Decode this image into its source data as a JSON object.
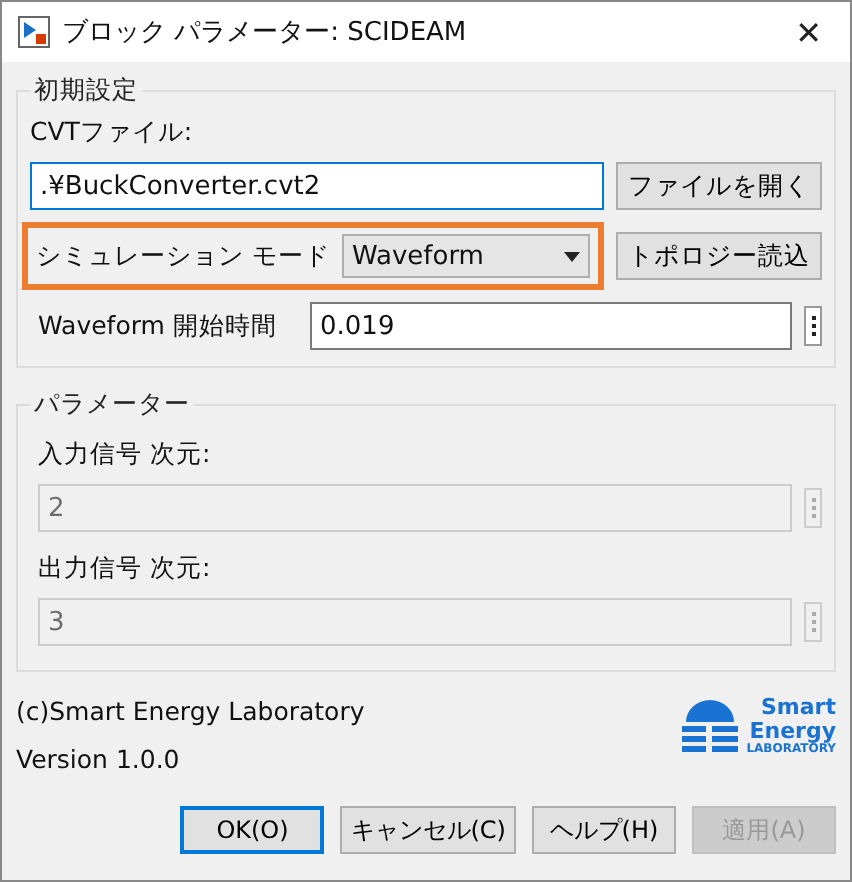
{
  "window": {
    "title": "ブロック パラメーター: SCIDEAM",
    "close": "✕"
  },
  "initial": {
    "title": "初期設定",
    "file_label": "CVTファイル:",
    "file_value": ".¥BuckConverter.cvt2",
    "open_button": "ファイルを開く",
    "mode": {
      "label": "シミュレーション モード",
      "value": "Waveform",
      "highlighted": true
    },
    "topology_button": "トポロジー読込",
    "start": {
      "label": "Waveform 開始時間",
      "value": "0.019"
    }
  },
  "parameters": {
    "title": "パラメーター",
    "fields": [
      {
        "label": "入力信号 次元:",
        "value": "2",
        "disabled": true
      },
      {
        "label": "出力信号 次元:",
        "value": "3",
        "disabled": true
      }
    ]
  },
  "footer": {
    "copyright": "(c)Smart Energy Laboratory",
    "version": "Version 1.0.0",
    "logo": [
      "Smart",
      "Energy",
      "LABORATORY"
    ]
  },
  "buttons": [
    {
      "label": "OK(O)",
      "default": true,
      "disabled": false
    },
    {
      "label": "キャンセル(C)",
      "default": false,
      "disabled": false
    },
    {
      "label": "ヘルプ(H)",
      "default": false,
      "disabled": false
    },
    {
      "label": "適用(A)",
      "default": false,
      "disabled": true
    }
  ]
}
